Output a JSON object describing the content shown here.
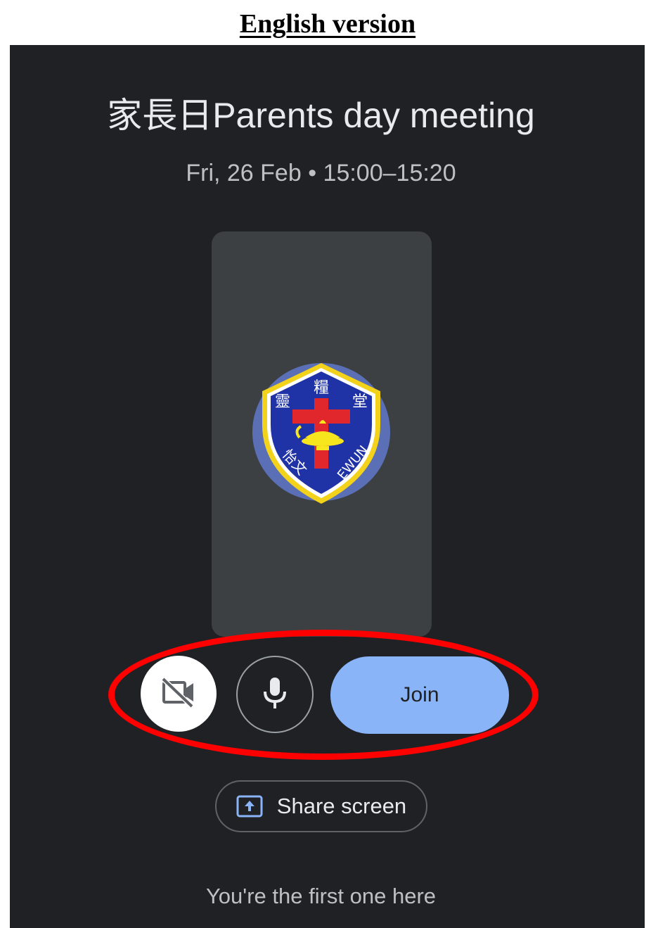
{
  "document": {
    "caption": "English version"
  },
  "meeting": {
    "title": "家長日Parents day meeting",
    "time": "Fri, 26 Feb • 15:00–15:20"
  },
  "logo": {
    "top_chars": [
      "靈",
      "糧",
      "堂"
    ],
    "left_text": "怡文",
    "right_text": "EWUN"
  },
  "controls": {
    "camera_icon": "video-off-icon",
    "mic_icon": "mic-icon",
    "join_label": "Join",
    "share_icon": "present-to-all-icon",
    "share_label": "Share screen"
  },
  "status": {
    "message": "You're the first one here"
  },
  "colors": {
    "background": "#202124",
    "tile": "#3c4043",
    "join_button": "#8ab4f8",
    "highlight": "#ff0000"
  }
}
